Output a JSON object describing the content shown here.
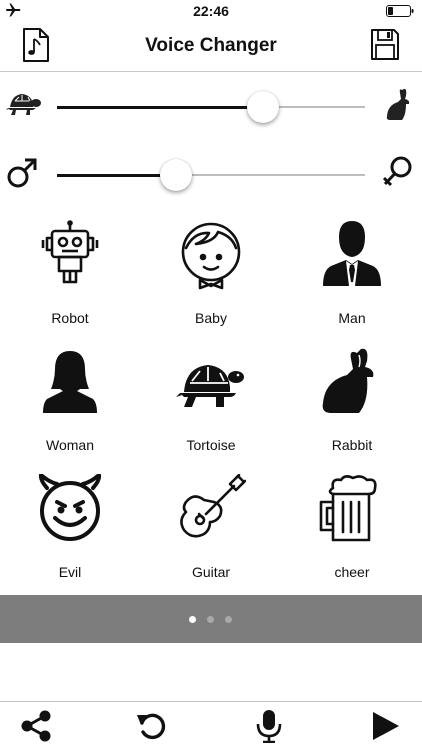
{
  "status_bar": {
    "time": "22:46"
  },
  "nav": {
    "title": "Voice Changer"
  },
  "sliders": {
    "speed": {
      "value": 0.67,
      "left_icon": "turtle-icon",
      "right_icon": "rabbit-icon"
    },
    "pitch": {
      "value": 0.385,
      "left_icon": "male-icon",
      "right_icon": "female-icon"
    }
  },
  "effects": [
    {
      "label": "Robot",
      "icon": "robot-icon"
    },
    {
      "label": "Baby",
      "icon": "baby-icon"
    },
    {
      "label": "Man",
      "icon": "man-icon"
    },
    {
      "label": "Woman",
      "icon": "woman-icon"
    },
    {
      "label": "Tortoise",
      "icon": "tortoise-icon"
    },
    {
      "label": "Rabbit",
      "icon": "rabbit-icon"
    },
    {
      "label": "Evil",
      "icon": "devil-icon"
    },
    {
      "label": "Guitar",
      "icon": "guitar-icon"
    },
    {
      "label": "cheer",
      "icon": "beer-icon"
    }
  ],
  "pager": {
    "pages": 3,
    "current": 0
  },
  "toolbar": [
    "share-icon",
    "undo-icon",
    "microphone-icon",
    "play-icon"
  ]
}
